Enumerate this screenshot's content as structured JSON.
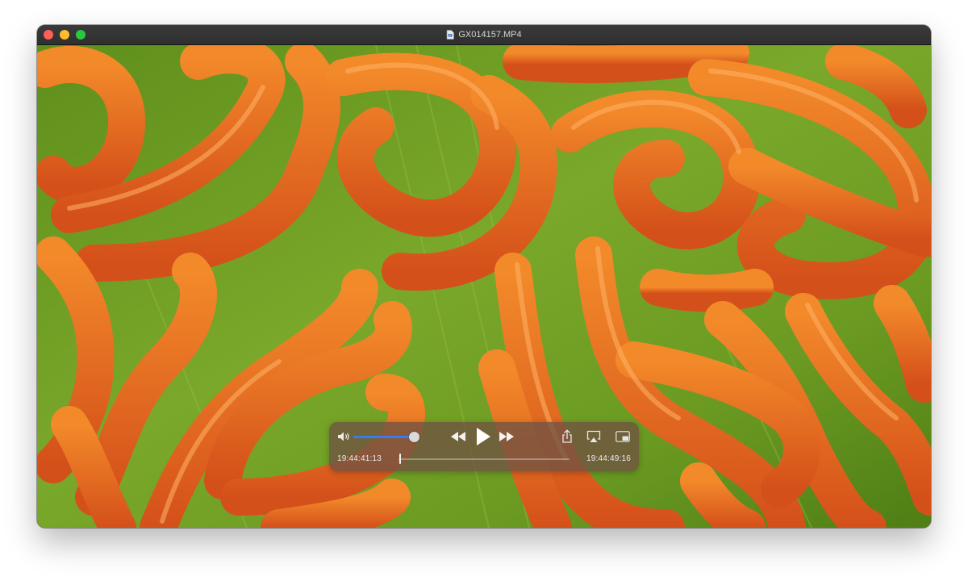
{
  "window": {
    "title": "GX014157.MP4"
  },
  "controls": {
    "volume_level": 0.99,
    "current_time": "19:44:41:13",
    "end_time": "19:44:49:16",
    "playback_progress": 0.005
  },
  "icons": {
    "volume": "speaker-icon",
    "rewind": "rewind-icon",
    "play": "play-icon",
    "fast_forward": "fast-forward-icon",
    "share": "share-icon",
    "airplay": "airplay-icon",
    "pip": "picture-in-picture-icon"
  },
  "colors": {
    "accent": "#3a7bf0",
    "close": "#ff5f57",
    "minimize": "#febc2e",
    "maximize": "#28c840"
  }
}
